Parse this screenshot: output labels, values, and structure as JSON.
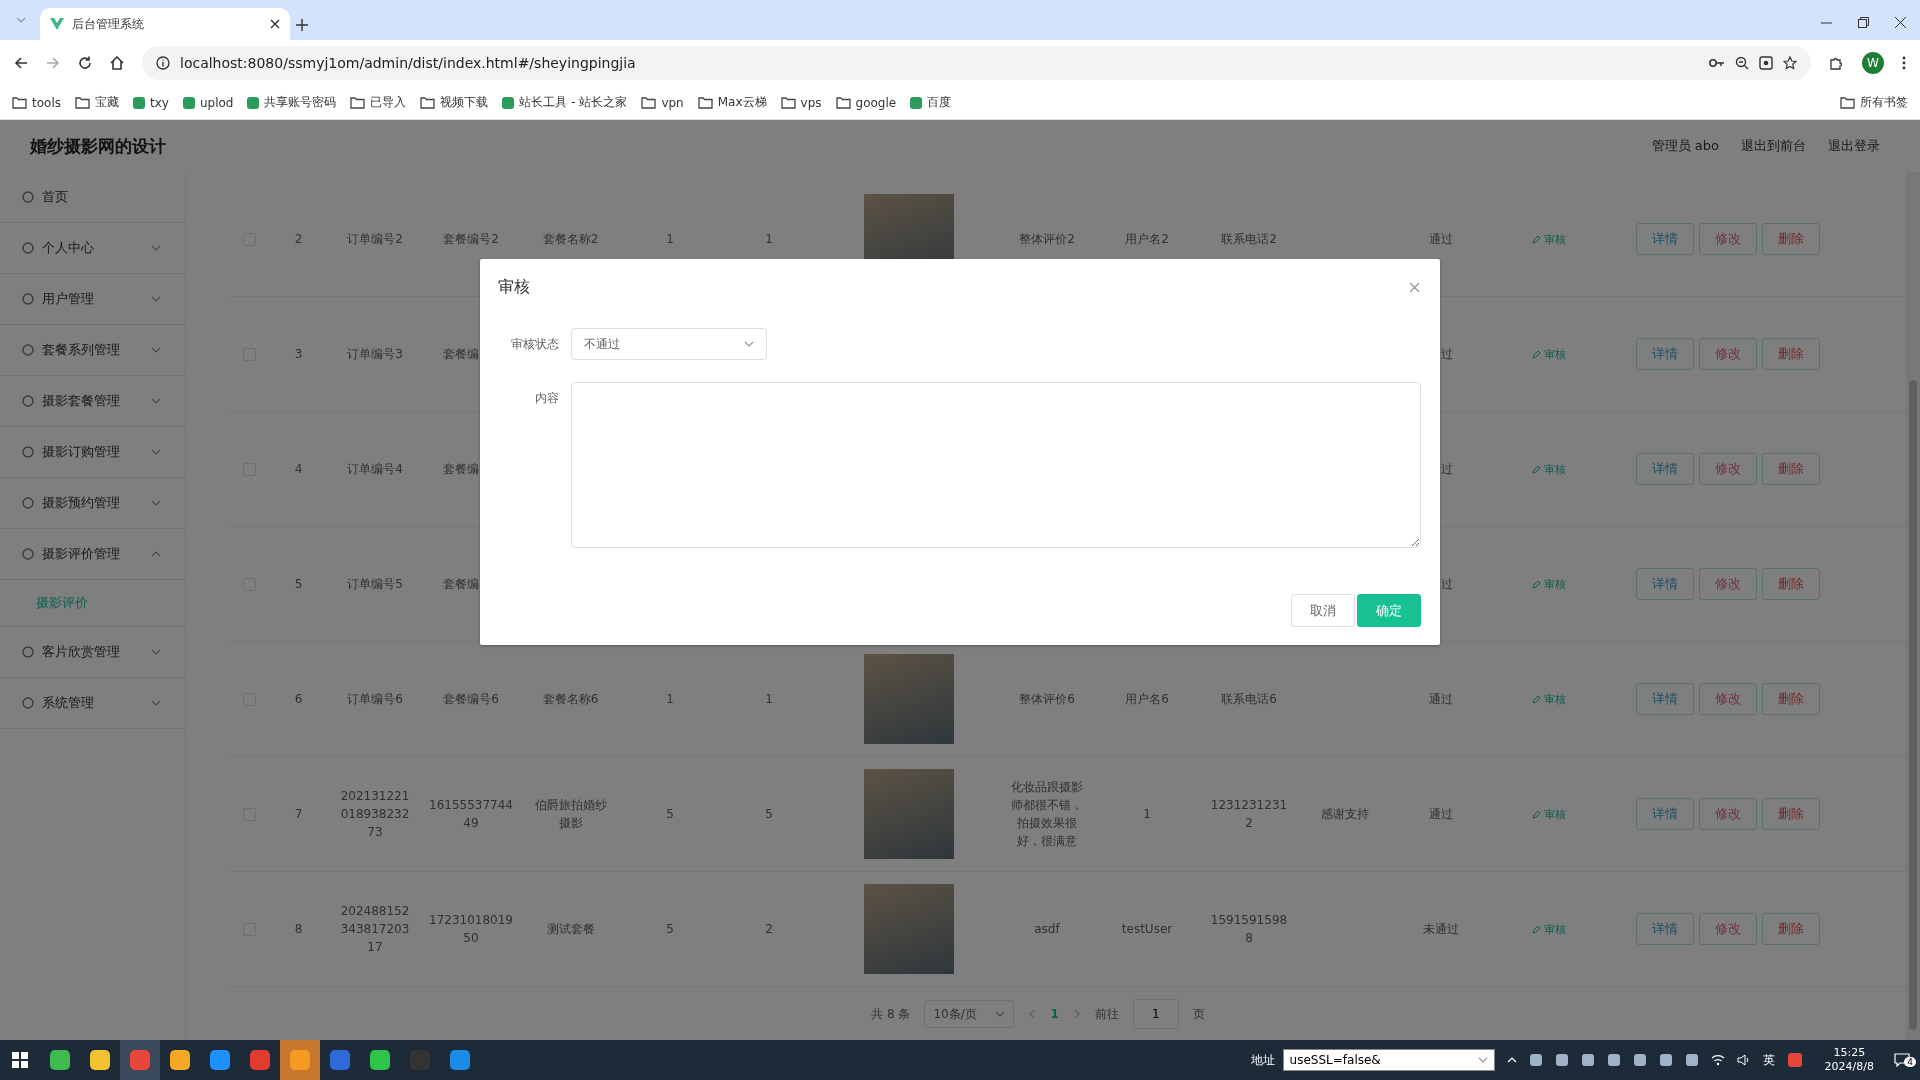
{
  "browser": {
    "tab": {
      "title": "后台管理系统"
    },
    "url": "localhost:8080/ssmyj1om/admin/dist/index.html#/sheyingpingjia",
    "profile": "W",
    "bookmarks": [
      {
        "label": "tools",
        "kind": "folder"
      },
      {
        "label": "宝藏",
        "kind": "folder"
      },
      {
        "label": "txy",
        "kind": "site"
      },
      {
        "label": "uplod",
        "kind": "site"
      },
      {
        "label": "共享账号密码",
        "kind": "site"
      },
      {
        "label": "已导入",
        "kind": "folder"
      },
      {
        "label": "视频下载",
        "kind": "folder"
      },
      {
        "label": "站长工具 - 站长之家",
        "kind": "site"
      },
      {
        "label": "vpn",
        "kind": "folder"
      },
      {
        "label": "Max云梯",
        "kind": "folder"
      },
      {
        "label": "vps",
        "kind": "folder"
      },
      {
        "label": "google",
        "kind": "folder"
      },
      {
        "label": "百度",
        "kind": "site"
      }
    ],
    "all_bookmarks": "所有书签"
  },
  "header": {
    "title": "婚纱摄影网的设计",
    "links": [
      "管理员 abo",
      "退出到前台",
      "退出登录"
    ]
  },
  "sidebar": {
    "items": [
      {
        "label": "首页",
        "kind": "link"
      },
      {
        "label": "个人中心",
        "kind": "menu",
        "expanded": false
      },
      {
        "label": "用户管理",
        "kind": "menu",
        "expanded": false
      },
      {
        "label": "套餐系列管理",
        "kind": "menu",
        "expanded": false
      },
      {
        "label": "摄影套餐管理",
        "kind": "menu",
        "expanded": false
      },
      {
        "label": "摄影订购管理",
        "kind": "menu",
        "expanded": false
      },
      {
        "label": "摄影预约管理",
        "kind": "menu",
        "expanded": false
      },
      {
        "label": "摄影评价管理",
        "kind": "menu",
        "expanded": true,
        "children": [
          {
            "label": "摄影评价",
            "selected": true
          }
        ]
      },
      {
        "label": "客片欣赏管理",
        "kind": "menu",
        "expanded": false
      },
      {
        "label": "系统管理",
        "kind": "menu",
        "expanded": false
      }
    ]
  },
  "table": {
    "rows": [
      {
        "kind": "full",
        "checked": false,
        "index": "2",
        "order_no": "订单编号2",
        "package_no": "套餐编号2",
        "package_name": "套餐名称2",
        "column_5": "1",
        "column_6": "1",
        "overall_review": "整体评价2",
        "username": "用户名2",
        "phone": "联系电话2",
        "status": "通过",
        "action": "审核",
        "buttons": [
          "详情",
          "修改",
          "删除"
        ]
      },
      {
        "kind": "covered",
        "checked": false,
        "index": "3",
        "order_no": "订单编号3",
        "package_no": "套餐编",
        "status": "过",
        "action": "审核",
        "buttons": [
          "详情",
          "修改",
          "删除"
        ]
      },
      {
        "kind": "covered",
        "checked": false,
        "index": "4",
        "order_no": "订单编号4",
        "package_no": "套餐编",
        "status": "过",
        "action": "审核",
        "buttons": [
          "详情",
          "修改",
          "删除"
        ]
      },
      {
        "kind": "covered",
        "checked": false,
        "index": "5",
        "order_no": "订单编号5",
        "package_no": "套餐编",
        "status": "过",
        "action": "审核",
        "buttons": [
          "详情",
          "修改",
          "删除"
        ]
      },
      {
        "kind": "full",
        "checked": false,
        "index": "6",
        "order_no": "订单编号6",
        "package_no": "套餐编号6",
        "package_name": "套餐名称6",
        "column_5": "1",
        "column_6": "1",
        "overall_review": "整体评价6",
        "username": "用户名6",
        "phone": "联系电话6",
        "status": "通过",
        "action": "审核",
        "buttons": [
          "详情",
          "修改",
          "删除"
        ]
      },
      {
        "kind": "full",
        "checked": false,
        "index": "7",
        "order_no": "20213122101893823273",
        "package_no": "1615553774449",
        "package_name": "伯爵旅拍婚纱摄影",
        "column_5": "5",
        "column_6": "5",
        "overall_review": "化妆品跟摄影师都很不错，拍摄效果很好，很满意",
        "username": "1",
        "phone": "12312312312",
        "reply": "感谢支持",
        "status": "通过",
        "action": "审核",
        "buttons": [
          "详情",
          "修改",
          "删除"
        ]
      },
      {
        "kind": "full",
        "checked": false,
        "index": "8",
        "order_no": "20248815234381720317",
        "package_no": "1723101801950",
        "package_name": "测试套餐",
        "column_5": "5",
        "column_6": "2",
        "overall_review": "asdf",
        "username": "testUser",
        "phone": "15915915988",
        "status": "未通过",
        "action": "审核",
        "buttons": [
          "详情",
          "修改",
          "删除"
        ]
      }
    ]
  },
  "pagination": {
    "total": "共 8 条",
    "page_size": "10条/页",
    "pages": [
      {
        "label": "1",
        "selected": true
      }
    ],
    "goto_label": "前往",
    "goto_value": "1",
    "page_unit": "页"
  },
  "dialog": {
    "title": "审核",
    "fields": [
      {
        "label": "审核状态",
        "kind": "select",
        "value": "不通过"
      },
      {
        "label": "内容",
        "kind": "textarea"
      }
    ],
    "buttons": [
      {
        "label": "取消",
        "kind": "secondary"
      },
      {
        "label": "确定",
        "kind": "primary"
      }
    ]
  },
  "taskbar": {
    "address_label": "地址",
    "address_value": "useSSL=false&",
    "ime": "英",
    "time": "15:25",
    "date": "2024/8/8",
    "notifications": "4"
  }
}
